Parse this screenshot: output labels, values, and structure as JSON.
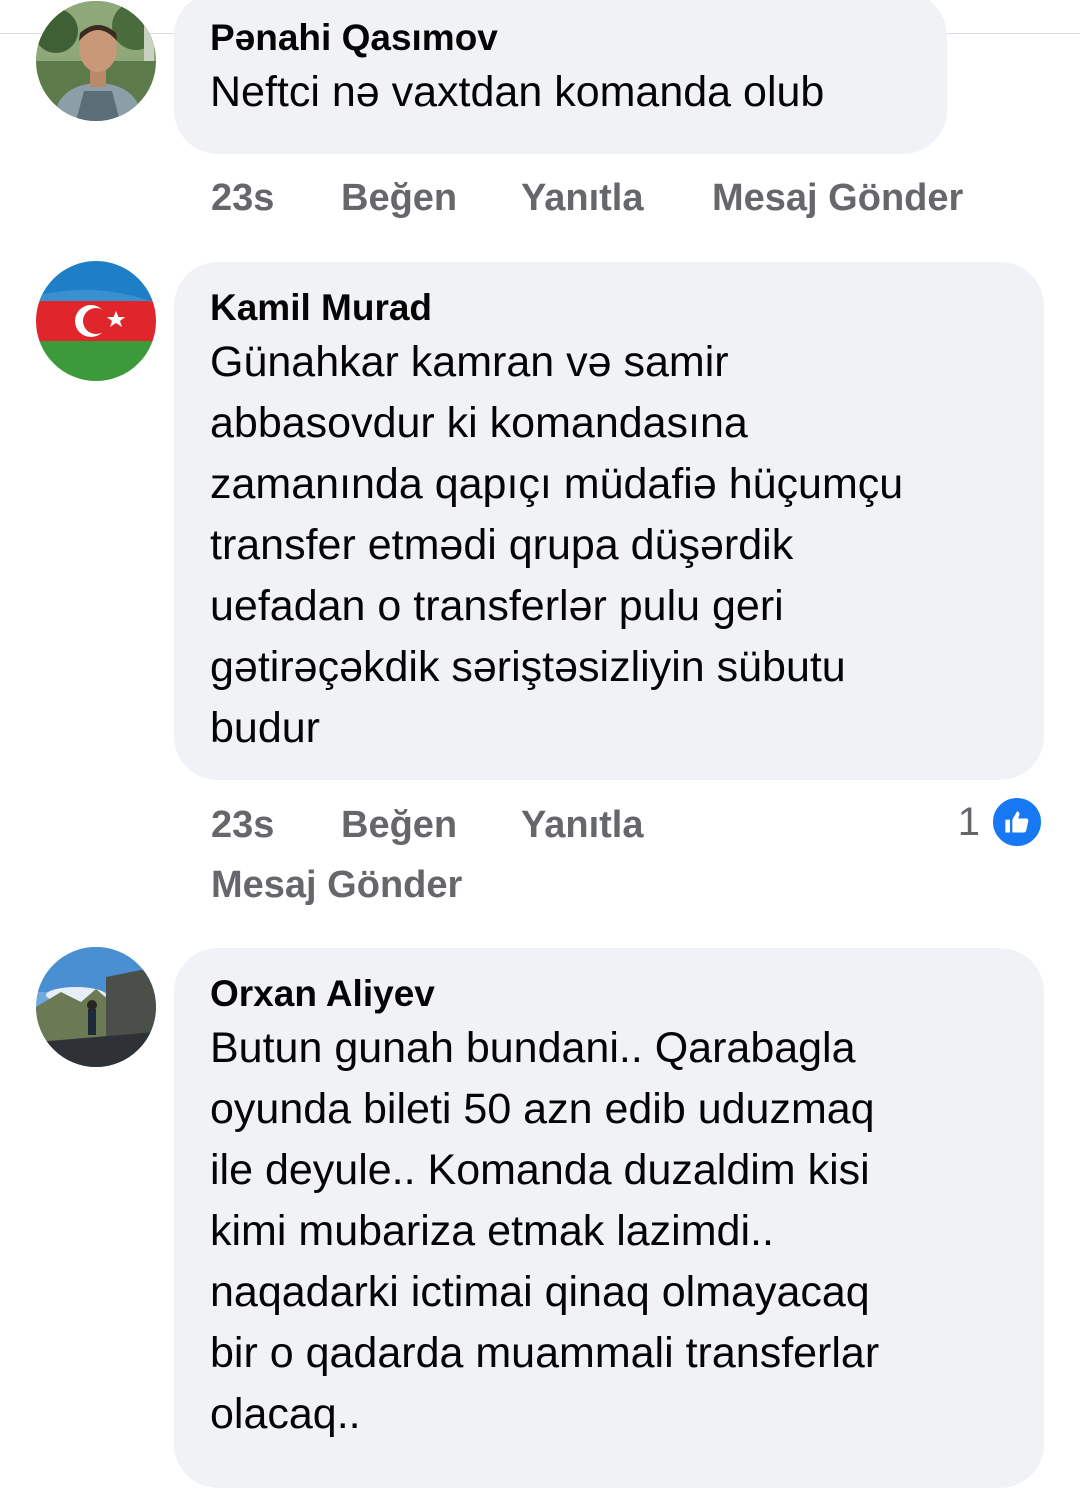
{
  "comments": [
    {
      "author": "Pənahi Qasımov",
      "text": "Neftci nə vaxtdan komanda olub",
      "time": "23s",
      "like_label": "Beğen",
      "reply_label": "Yanıtla",
      "message_label": "Mesaj Gönder"
    },
    {
      "author": "Kamil Murad",
      "text": "Günahkar kamran və samir\nabbasovdur ki komandasına\nzamanında qapıçı müdafiə hüçumçu\ntransfer etmədi qrupa düşərdik\nuefadan o transferlər pulu geri\ngətirəçəkdik səriştəsizliyin sübutu\nbudur",
      "time": "23s",
      "like_label": "Beğen",
      "reply_label": "Yanıtla",
      "message_label": "Mesaj Gönder",
      "reaction_count": "1",
      "reaction_icon": "thumbs-up-icon",
      "accent": "#1877f2"
    },
    {
      "author": "Orxan Aliyev",
      "text": "Butun gunah bundani.. Qarabagla\noyunda bileti 50 azn edib uduzmaq\nile deyule.. Komanda duzaldim kisi\nkimi mubariza etmak lazimdi..\nnaqadarki ictimai qinaq olmayacaq\nbir o qadarda muammali transferlar\nolacaq.."
    }
  ]
}
